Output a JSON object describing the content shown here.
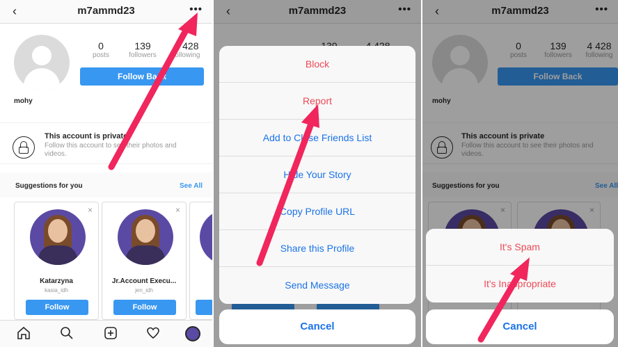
{
  "profile": {
    "username": "m7ammd23",
    "display_name": "mohy",
    "posts": {
      "value": "0",
      "label": "posts"
    },
    "followers": {
      "value": "139",
      "label": "followers"
    },
    "following": {
      "value": "4 428",
      "label": "following"
    },
    "follow_back": "Follow Back",
    "more_glyph": "•••",
    "back_glyph": "‹"
  },
  "private": {
    "title": "This account is private",
    "desc": "Follow this account to see their photos and videos."
  },
  "suggestions": {
    "title": "Suggestions for you",
    "see_all": "See All",
    "cards": [
      {
        "name": "Katarzyna",
        "handle": "kasia_idh",
        "follow": "Follow",
        "close": "×"
      },
      {
        "name": "Jr.Account Execu...",
        "handle": "jen_idh",
        "follow": "Follow",
        "close": "×"
      }
    ]
  },
  "tabbar": {
    "icons": [
      "home-icon",
      "search-icon",
      "add-post-icon",
      "heart-icon",
      "profile-avatar"
    ]
  },
  "action_sheet": {
    "items": [
      "Block",
      "Report",
      "Add to Close Friends List",
      "Hide Your Story",
      "Copy Profile URL",
      "Share this Profile",
      "Send Message"
    ],
    "cancel": "Cancel"
  },
  "report_sheet": {
    "items": [
      "It's Spam",
      "It's Inappropriate"
    ],
    "cancel": "Cancel"
  },
  "colors": {
    "accent": "#3897f0",
    "destructive": "#ed4956",
    "arrow": "#f0265d"
  }
}
